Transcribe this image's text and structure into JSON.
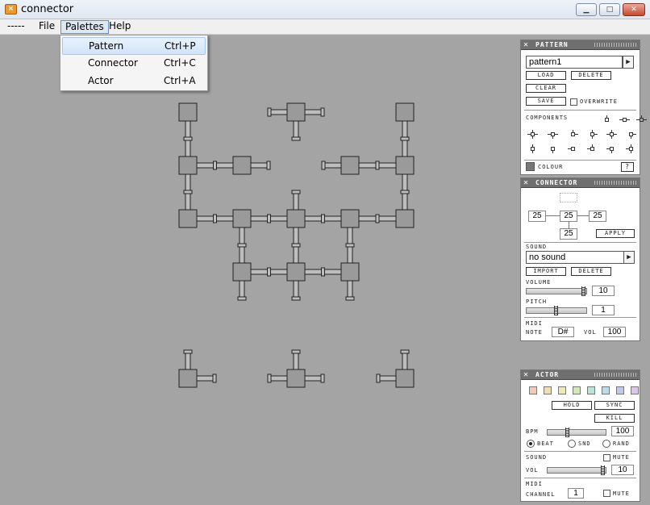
{
  "window": {
    "title": "connector",
    "icon": "app-x-icon",
    "minimize": "minimize-icon",
    "maximize": "maximize-icon",
    "close": "close-icon"
  },
  "menubar": {
    "items": [
      "-----",
      "File",
      "Palettes",
      "Help"
    ],
    "open": "Palettes"
  },
  "palettes_menu": [
    {
      "label": "Pattern",
      "shortcut": "Ctrl+P"
    },
    {
      "label": "Connector",
      "shortcut": "Ctrl+C"
    },
    {
      "label": "Actor",
      "shortcut": "Ctrl+A"
    }
  ],
  "pattern_panel": {
    "title": "PATTERN",
    "pattern_name": "pattern1",
    "load": "LOAD",
    "delete": "DELETE",
    "clear": "CLEAR",
    "save": "SAVE",
    "overwrite": "OVERWRITE",
    "components_label": "COMPONENTS",
    "colour": "COLOUR",
    "help": "?"
  },
  "connector_panel": {
    "title": "CONNECTOR",
    "left": "25",
    "center": "25",
    "right": "25",
    "bottom": "25",
    "apply": "APPLY",
    "sound_label": "SOUND",
    "sound": "no sound",
    "import": "IMPORT",
    "delete": "DELETE",
    "volume_label": "VOLUME",
    "volume": "10",
    "volume_level": 1.0,
    "pitch_label": "PITCH",
    "pitch": "1",
    "pitch_level": 0.5,
    "midi_label": "MIDI",
    "note_label": "NOTE",
    "note": "D#",
    "vol_label": "VOL",
    "vol": "100"
  },
  "actor_panel": {
    "title": "ACTOR",
    "swatches": [
      "#f3c9b8",
      "#f2dcb3",
      "#ecebb5",
      "#cfe9b9",
      "#b8e6d3",
      "#b8dce9",
      "#bfc9ec",
      "#dcc6ec"
    ],
    "hold": "HOLD",
    "sync": "SYNC",
    "kill": "KILL",
    "bpm_label": "BPM",
    "bpm": "100",
    "bpm_level": 0.33,
    "beat": "BEAT",
    "snd": "SND",
    "rand": "RAND",
    "sound_label": "SOUND",
    "mute": "MUTE",
    "vol_label": "VOL",
    "vol": "10",
    "vol_level": 1.0,
    "midi_label": "MIDI",
    "channel_label": "CHANNEL",
    "channel": "1",
    "midi_mute": "MUTE"
  }
}
